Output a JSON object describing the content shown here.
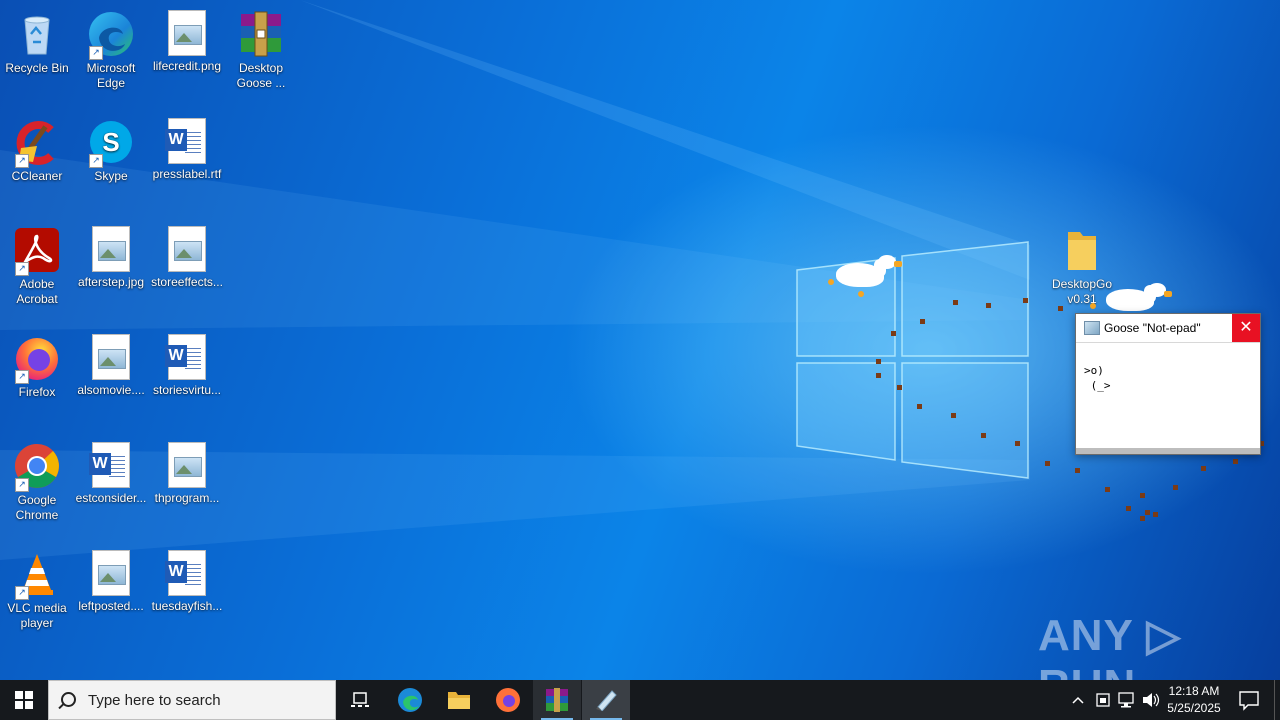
{
  "desktop_icons": [
    {
      "label": "Recycle Bin",
      "icon": "recycle-bin-icon"
    },
    {
      "label": "Microsoft Edge",
      "icon": "edge-icon"
    },
    {
      "label": "lifecredit.png",
      "icon": "image-file-icon"
    },
    {
      "label": "Desktop Goose ...",
      "icon": "winrar-archive-icon"
    },
    {
      "label": "CCleaner",
      "icon": "ccleaner-icon"
    },
    {
      "label": "Skype",
      "icon": "skype-icon"
    },
    {
      "label": "presslabel.rtf",
      "icon": "word-document-icon"
    },
    {
      "label": "Adobe Acrobat",
      "icon": "acrobat-icon"
    },
    {
      "label": "afterstep.jpg",
      "icon": "image-file-icon"
    },
    {
      "label": "storeeffects...",
      "icon": "image-file-icon"
    },
    {
      "label": "Firefox",
      "icon": "firefox-icon"
    },
    {
      "label": "alsomovie....",
      "icon": "image-file-icon"
    },
    {
      "label": "storiesvirtu...",
      "icon": "word-document-icon"
    },
    {
      "label": "Google Chrome",
      "icon": "chrome-icon"
    },
    {
      "label": "estconsider...",
      "icon": "word-document-icon"
    },
    {
      "label": "thprogram...",
      "icon": "image-file-icon"
    },
    {
      "label": "VLC media player",
      "icon": "vlc-icon"
    },
    {
      "label": "leftposted....",
      "icon": "image-file-icon"
    },
    {
      "label": "tuesdayfish...",
      "icon": "word-document-icon"
    }
  ],
  "folder_icon": {
    "label": "DesktopGoose v0.31",
    "label_line1": "DesktopGo",
    "label_line2": "v0.31"
  },
  "notepad": {
    "title": "Goose \"Not-epad\"",
    "close": "✕",
    "text": ">o)\n (_>"
  },
  "watermark": "ANY ▷ RUN",
  "taskbar": {
    "search_placeholder": "Type here to search",
    "pinned": [
      "task-view",
      "edge",
      "file-explorer",
      "firefox",
      "winrar",
      "notepad"
    ],
    "clock_time": "12:18 AM",
    "clock_date": "5/25/2025"
  }
}
